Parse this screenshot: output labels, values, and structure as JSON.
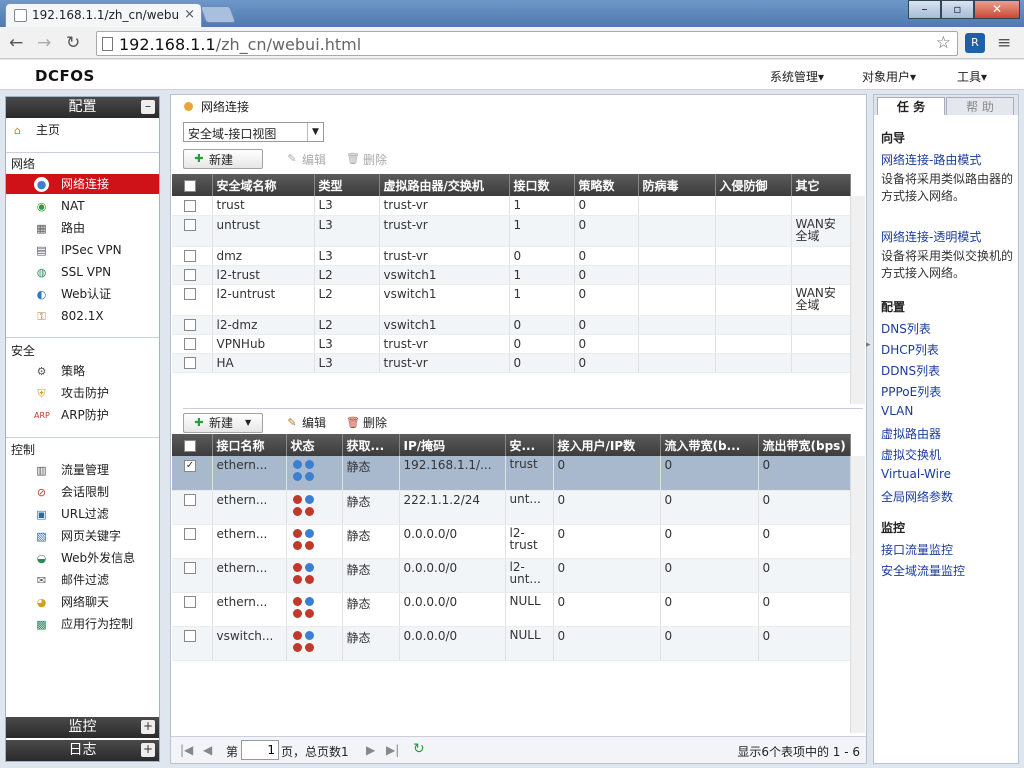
{
  "browser": {
    "tab_title": "192.168.1.1/zh_cn/webu",
    "url_host": "192.168.1.1",
    "url_path": "/zh_cn/webui.html"
  },
  "app": {
    "logo": "DCFOS",
    "menus": [
      "系统管理▾",
      "对象用户▾",
      "工具▾"
    ]
  },
  "sidebar": {
    "header": "配置",
    "home": "主页",
    "sections": [
      {
        "title": "网络",
        "items": [
          {
            "label": "网络连接",
            "icon": "globe-icon",
            "active": true
          },
          {
            "label": "NAT",
            "icon": "nat-icon"
          },
          {
            "label": "路由",
            "icon": "route-icon"
          },
          {
            "label": "IPSec VPN",
            "icon": "ipsec-icon"
          },
          {
            "label": "SSL VPN",
            "icon": "ssl-icon"
          },
          {
            "label": "Web认证",
            "icon": "web-auth-icon"
          },
          {
            "label": "802.1X",
            "icon": "8021x-icon"
          }
        ]
      },
      {
        "title": "安全",
        "items": [
          {
            "label": "策略",
            "icon": "policy-icon"
          },
          {
            "label": "攻击防护",
            "icon": "shield-icon"
          },
          {
            "label": "ARP防护",
            "icon": "arp-icon"
          }
        ]
      },
      {
        "title": "控制",
        "items": [
          {
            "label": "流量管理",
            "icon": "traffic-icon"
          },
          {
            "label": "会话限制",
            "icon": "session-icon"
          },
          {
            "label": "URL过滤",
            "icon": "url-icon"
          },
          {
            "label": "网页关键字",
            "icon": "keyword-icon"
          },
          {
            "label": "Web外发信息",
            "icon": "web-out-icon"
          },
          {
            "label": "邮件过滤",
            "icon": "mail-icon"
          },
          {
            "label": "网络聊天",
            "icon": "chat-icon"
          },
          {
            "label": "应用行为控制",
            "icon": "app-control-icon"
          }
        ]
      }
    ],
    "bottom": [
      "监控",
      "日志"
    ]
  },
  "main": {
    "breadcrumb": "网络连接",
    "view_select": "安全域-接口视图",
    "toolbar1": {
      "new": "新建",
      "edit": "编辑",
      "delete": "删除"
    },
    "zones": {
      "columns": [
        "安全域名称",
        "类型",
        "虚拟路由器/交换机",
        "接口数",
        "策略数",
        "防病毒",
        "入侵防御",
        "其它"
      ],
      "rows": [
        [
          "trust",
          "L3",
          "trust-vr",
          "1",
          "0",
          "",
          "",
          ""
        ],
        [
          "untrust",
          "L3",
          "trust-vr",
          "1",
          "0",
          "",
          "",
          "WAN安全域"
        ],
        [
          "dmz",
          "L3",
          "trust-vr",
          "0",
          "0",
          "",
          "",
          ""
        ],
        [
          "l2-trust",
          "L2",
          "vswitch1",
          "1",
          "0",
          "",
          "",
          ""
        ],
        [
          "l2-untrust",
          "L2",
          "vswitch1",
          "1",
          "0",
          "",
          "",
          "WAN安全域"
        ],
        [
          "l2-dmz",
          "L2",
          "vswitch1",
          "0",
          "0",
          "",
          "",
          ""
        ],
        [
          "VPNHub",
          "L3",
          "trust-vr",
          "0",
          "0",
          "",
          "",
          ""
        ],
        [
          "HA",
          "L3",
          "trust-vr",
          "0",
          "0",
          "",
          "",
          ""
        ]
      ]
    },
    "toolbar2": {
      "new": "新建",
      "edit": "编辑",
      "delete": "删除"
    },
    "interfaces": {
      "columns": [
        "接口名称",
        "状态",
        "获取...",
        "IP/掩码",
        "安...",
        "接入用户/IP数",
        "流入带宽(b...",
        "流出带宽(bps)"
      ],
      "rows": [
        [
          "ethern...",
          "",
          "静态",
          "192.168.1.1/...",
          "trust",
          "0",
          "0",
          "0"
        ],
        [
          "ethern...",
          "",
          "静态",
          "222.1.1.2/24",
          "unt...",
          "0",
          "0",
          "0"
        ],
        [
          "ethern...",
          "",
          "静态",
          "0.0.0.0/0",
          "l2-trust",
          "0",
          "0",
          "0"
        ],
        [
          "ethern...",
          "",
          "静态",
          "0.0.0.0/0",
          "l2-unt...",
          "0",
          "0",
          "0"
        ],
        [
          "ethern...",
          "",
          "静态",
          "0.0.0.0/0",
          "NULL",
          "0",
          "0",
          "0"
        ],
        [
          "vswitch...",
          "",
          "静态",
          "0.0.0.0/0",
          "NULL",
          "0",
          "0",
          "0"
        ]
      ]
    },
    "pager": {
      "page_prefix": "第",
      "page_value": "1",
      "page_suffix": "页，总页数1",
      "summary": "显示6个表项中的 1 - 6"
    }
  },
  "right_panel": {
    "tabs": [
      "任 务",
      "帮 助"
    ],
    "wizard_title": "向导",
    "wizard": [
      {
        "link": "网络连接-路由模式",
        "desc": "设备将采用类似路由器的方式接入网络。"
      },
      {
        "link": "网络连接-透明模式",
        "desc": "设备将采用类似交换机的方式接入网络。"
      }
    ],
    "config_title": "配置",
    "config_links": [
      "DNS列表",
      "DHCP列表",
      "DDNS列表",
      "PPPoE列表",
      "VLAN",
      "虚拟路由器",
      "虚拟交换机",
      "Virtual-Wire",
      "全局网络参数"
    ],
    "monitor_title": "监控",
    "monitor_links": [
      "接口流量监控",
      "安全域流量监控"
    ]
  }
}
